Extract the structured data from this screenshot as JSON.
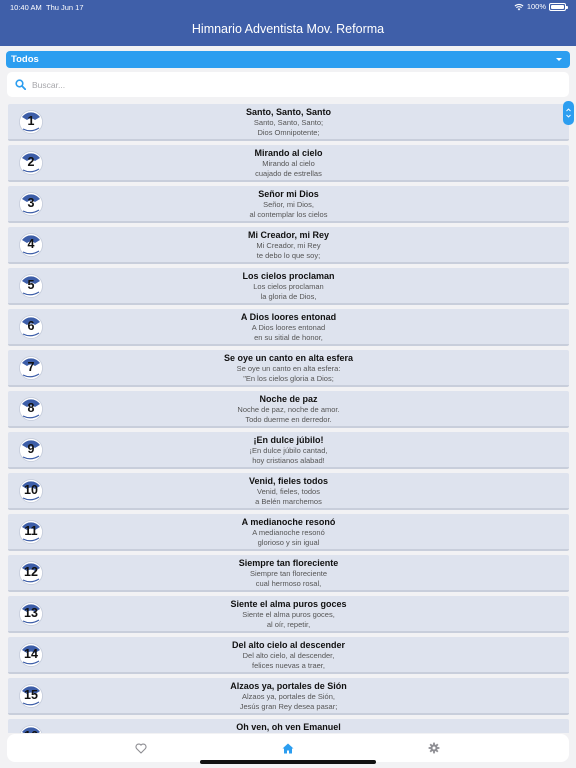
{
  "status_bar": {
    "time": "10:40 AM",
    "date": "Thu Jun 17",
    "battery": "100%"
  },
  "app": {
    "title": "Himnario Adventista Mov. Reforma"
  },
  "category": {
    "selected": "Todos"
  },
  "search": {
    "placeholder": "Buscar..."
  },
  "hymns": [
    {
      "number": "1",
      "title": "Santo, Santo, Santo",
      "line1": "Santo, Santo, Santo;",
      "line2": "Dios Omnipotente;"
    },
    {
      "number": "2",
      "title": "Mirando al cielo",
      "line1": "Mirando al cielo",
      "line2": "cuajado de estrellas"
    },
    {
      "number": "3",
      "title": "Señor mi Dios",
      "line1": "Señor, mi Dios,",
      "line2": "al contemplar los cielos"
    },
    {
      "number": "4",
      "title": "Mi Creador, mi Rey",
      "line1": "Mi Creador, mi Rey",
      "line2": "te debo lo que soy;"
    },
    {
      "number": "5",
      "title": "Los cielos proclaman",
      "line1": "Los cielos proclaman",
      "line2": "la gloria de Dios,"
    },
    {
      "number": "6",
      "title": "A Dios loores entonad",
      "line1": "A Dios loores entonad",
      "line2": "en su sitial de honor,"
    },
    {
      "number": "7",
      "title": "Se oye un canto en alta esfera",
      "line1": "Se oye un canto en alta esfera:",
      "line2": "\"En los cielos gloria a Dios;"
    },
    {
      "number": "8",
      "title": "Noche de paz",
      "line1": "Noche de paz, noche de amor.",
      "line2": "Todo duerme en derredor."
    },
    {
      "number": "9",
      "title": "¡En dulce júbilo!",
      "line1": "¡En dulce júbilo cantad,",
      "line2": "hoy cristianos alabad!"
    },
    {
      "number": "10",
      "title": "Venid, fieles todos",
      "line1": "Venid, fieles, todos",
      "line2": "a Belén marchemos"
    },
    {
      "number": "11",
      "title": "A medianoche resonó",
      "line1": "A medianoche resonó",
      "line2": "glorioso y sin igual"
    },
    {
      "number": "12",
      "title": "Siempre tan floreciente",
      "line1": "Siempre tan floreciente",
      "line2": "cual hermoso rosal,"
    },
    {
      "number": "13",
      "title": "Siente el alma puros goces",
      "line1": "Siente el alma puros goces,",
      "line2": "al oír, repetir,"
    },
    {
      "number": "14",
      "title": "Del alto cielo al descender",
      "line1": "Del alto cielo, al descender,",
      "line2": "felices nuevas a traer,"
    },
    {
      "number": "15",
      "title": "Alzaos ya, portales de Sión",
      "line1": "Alzaos ya, portales de Sión,",
      "line2": "Jesús gran Rey desea pasar;"
    },
    {
      "number": "16",
      "title": "Oh ven, oh ven Emanuel",
      "line1": "",
      "line2": ""
    }
  ],
  "bottom_nav": {
    "items": [
      "heart-icon",
      "home-icon",
      "gear-icon"
    ],
    "active": "home-icon"
  },
  "colors": {
    "header": "#3f5fa9",
    "accent": "#2c9ef0",
    "item_bg": "#dee3ee",
    "nav_active": "#2c9ef0",
    "nav_inactive": "#8e8e93"
  }
}
